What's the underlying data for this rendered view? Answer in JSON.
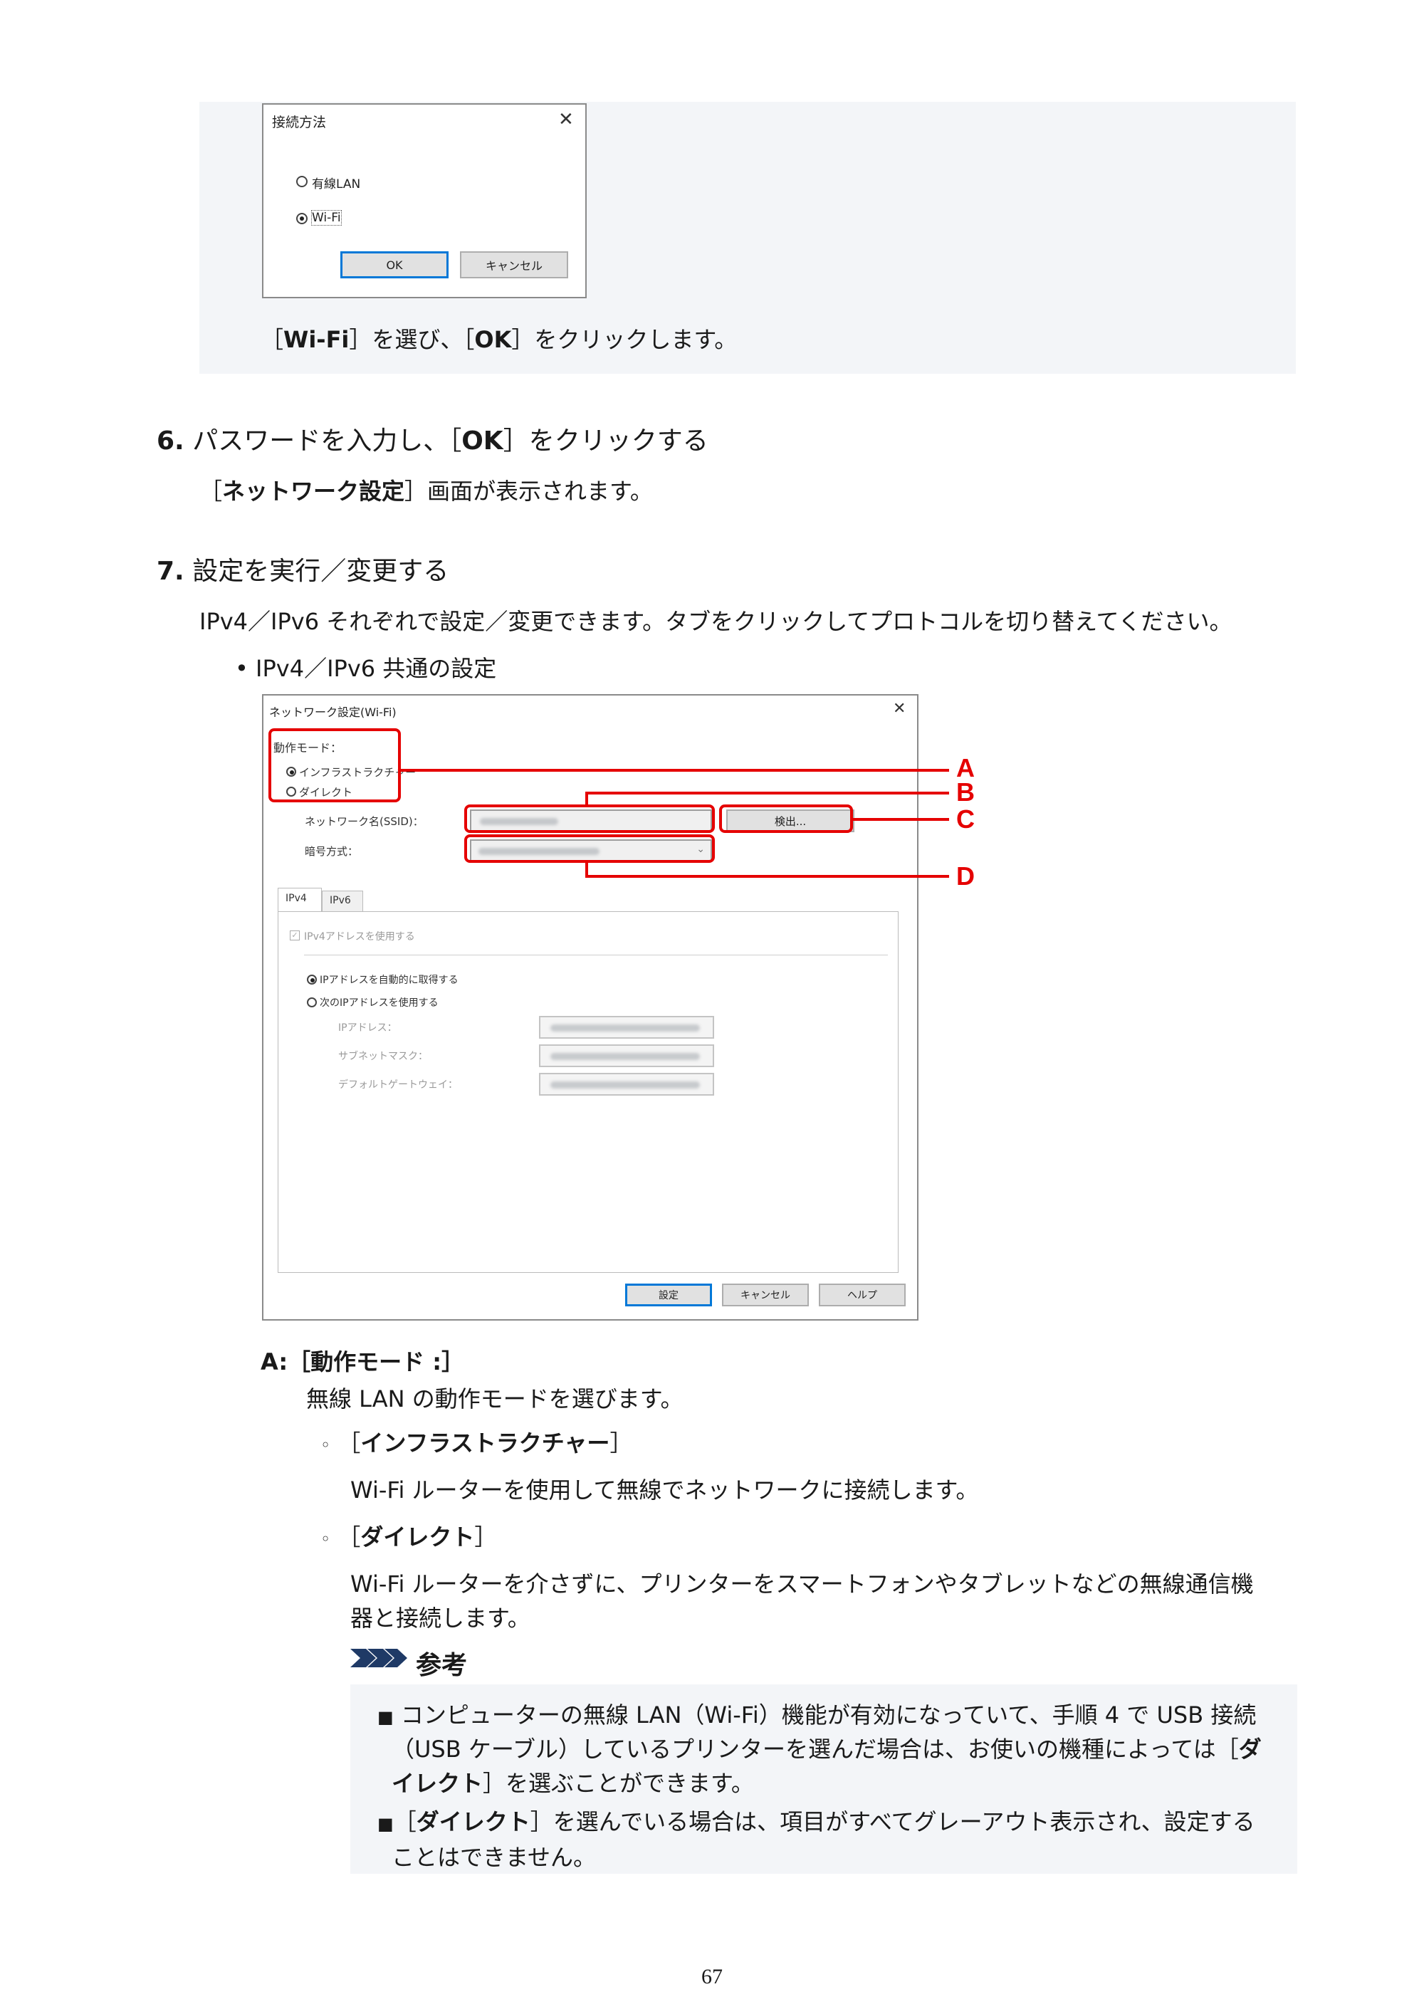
{
  "dialog1": {
    "title": "接続方法",
    "options": [
      "有線LAN",
      "Wi-Fi"
    ],
    "selected": "Wi-Fi",
    "ok_label": "OK",
    "cancel_label": "キャンセル"
  },
  "caption1": {
    "pre1": "［",
    "b1": "Wi-Fi",
    "mid": "］を選び、［",
    "b2": "OK",
    "post": "］をクリックします。"
  },
  "step6": {
    "num": "6.",
    "pre": "パスワードを入力し、［",
    "bold": "OK",
    "post": "］をクリックする",
    "desc_pre": "［",
    "desc_bold": "ネットワーク設定",
    "desc_post": "］画面が表示されます。"
  },
  "step7": {
    "num": "7.",
    "title": "設定を実行／変更する",
    "desc": "IPv4／IPv6 それぞれで設定／変更できます。タブをクリックしてプロトコルを切り替えてください。",
    "bullet": "IPv4／IPv6 共通の設定"
  },
  "dialog2": {
    "title": "ネットワーク設定(Wi-Fi)",
    "mode_label": "動作モード：",
    "mode_options": [
      "インフラストラクチャー",
      "ダイレクト"
    ],
    "ssid_label": "ネットワーク名(SSID)：",
    "detect_label": "検出...",
    "enc_label": "暗号方式：",
    "tabs": [
      "IPv4",
      "IPv6"
    ],
    "use_ipv4": "IPv4アドレスを使用する",
    "auto_ip": "IPアドレスを自動的に取得する",
    "manual_ip": "次のIPアドレスを使用する",
    "ip_label": "IPアドレス：",
    "mask_label": "サブネットマスク：",
    "gw_label": "デフォルトゲートウェイ：",
    "set_label": "設定",
    "cancel_label": "キャンセル",
    "help_label": "ヘルプ",
    "callouts": [
      "A",
      "B",
      "C",
      "D"
    ],
    "highlight_color": "#e50000"
  },
  "sectionA": {
    "heading": "A:［動作モード :］",
    "desc": "無線 LAN の動作モードを選びます。",
    "items": [
      {
        "pre": "［",
        "bold": "インフラストラクチャー",
        "post": "］",
        "desc1": "Wi-Fi ルーターを使用して無線でネットワークに接続します。",
        "desc2": ""
      },
      {
        "pre": "［",
        "bold": "ダイレクト",
        "post": "］",
        "desc1": "Wi-Fi ルーターを介さずに、プリンターをスマートフォンやタブレットなどの無線通信機",
        "desc2": "器と接続します。"
      }
    ]
  },
  "note": {
    "title": "参考",
    "item1_line1": "コンピューターの無線 LAN（Wi-Fi）機能が有効になっていて、手順 4 で USB 接続",
    "item1_line2_pre": "（USB ケーブル）しているプリンターを選んだ場合は、お使いの機種によっては［",
    "item1_line2_bold": "ダ",
    "item1_line3_bold": "イレクト",
    "item1_line3_post": "］を選ぶことができます。",
    "item2_pre": "［",
    "item2_bold": "ダイレクト",
    "item2_post": "］を選んでいる場合は、項目がすべてグレーアウト表示され、設定する",
    "item2_line2": "ことはできません。"
  },
  "page_number": "67"
}
